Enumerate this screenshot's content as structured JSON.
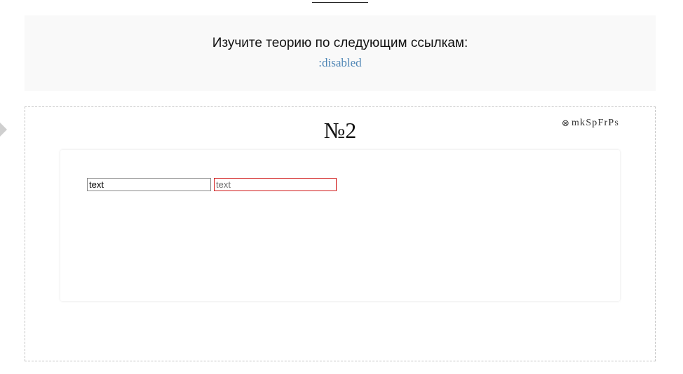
{
  "theory": {
    "heading": "Изучите теорию по следующим ссылкам:",
    "link": ":disabled"
  },
  "task": {
    "number": "№2",
    "code_icon": "circled-times-icon",
    "code": "mkSpFrPs"
  },
  "demo": {
    "input_enabled_value": "text",
    "input_disabled_value": "text"
  },
  "colors": {
    "link": "#4f86b5",
    "disabled_border": "#d01818",
    "panel_bg": "#f9f9f9"
  }
}
